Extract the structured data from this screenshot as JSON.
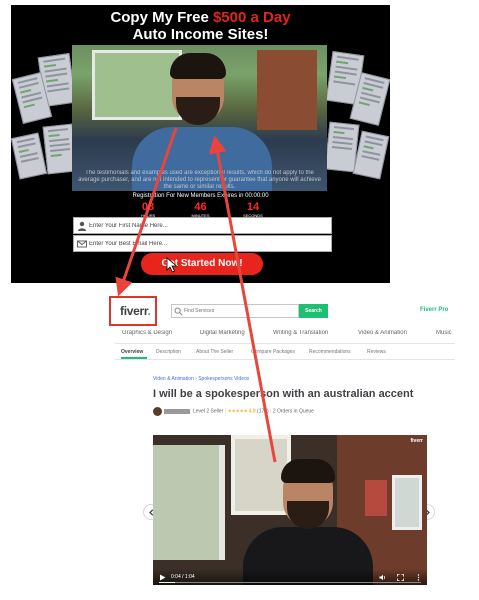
{
  "sales": {
    "headline_line1_pre": "Copy My Free ",
    "headline_highlight": "$500 a Day",
    "headline_line2": "Auto Income Sites!",
    "disclaimer": "The testimonials and examples used are exceptional results, which do not apply to the average purchaser, and are not intended to represent or guarantee that anyone will achieve the same or similar results.",
    "registration_text": "Registration For New Members Expires in 00:00:00",
    "timer": [
      {
        "value": "08",
        "label": "HOURS"
      },
      {
        "value": "46",
        "label": "MINUTES"
      },
      {
        "value": "14",
        "label": "SECONDS"
      }
    ],
    "name_placeholder": "Enter Your First Name Here...",
    "email_placeholder": "Enter Your Best Email Here...",
    "cta_label": "Get Started Now!",
    "accent_color": "#e8251c"
  },
  "fiverr": {
    "logo_text": "fiverr",
    "logo_dot": ".",
    "search_placeholder": "Find Services",
    "search_button": "Search",
    "pro_label": "Fiverr Pro",
    "categories": [
      "Graphics & Design",
      "Digital Marketing",
      "Writing & Translation",
      "Video & Animation",
      "Music"
    ],
    "tabs": [
      "Overview",
      "Description",
      "About The Seller",
      "Compare Packages",
      "Recommendations",
      "Reviews"
    ],
    "active_tab": "Overview",
    "breadcrumb": "Video & Animation › Spokespersons Videos",
    "gig_title": "I will be a spokesperson with an australian accent",
    "seller": {
      "level": "Level 2 Seller",
      "stars": "★★★★★",
      "rating": "4.9",
      "reviews": "(179)",
      "queue": "2 Orders in Queue"
    },
    "video": {
      "watermark": "fiverr",
      "time": "0:04 / 1:04",
      "progress": 0.0625
    },
    "brand_color": "#1dbf73"
  }
}
